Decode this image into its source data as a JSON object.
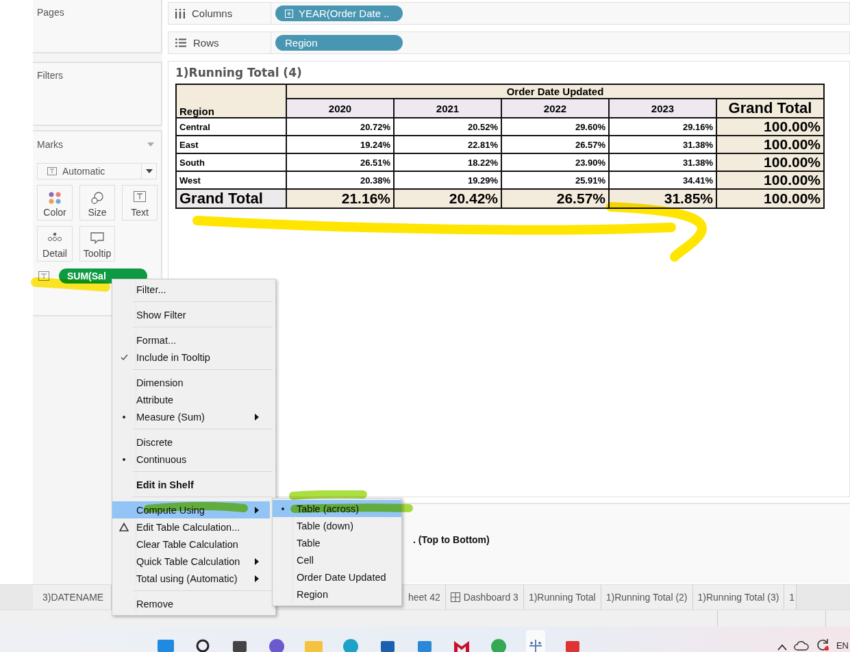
{
  "panels": {
    "pages": "Pages",
    "filters": "Filters",
    "marks": "Marks"
  },
  "mark_type": "Automatic",
  "mark_buttons": [
    {
      "label": "Color",
      "kind": "color"
    },
    {
      "label": "Size",
      "kind": "size"
    },
    {
      "label": "Text",
      "kind": "text"
    },
    {
      "label": "Detail",
      "kind": "detail"
    },
    {
      "label": "Tooltip",
      "kind": "tooltip"
    }
  ],
  "mark_pill": {
    "label": "SUM(Sal"
  },
  "shelves": [
    {
      "label": "Columns",
      "kind": "columns",
      "pill": "YEAR(Order Date ..",
      "pill_icon": true
    },
    {
      "label": "Rows",
      "kind": "rows",
      "pill": "Region",
      "pill_icon": false
    }
  ],
  "view": {
    "title": "1)Running Total (4)",
    "table": {
      "group_header": "Order Date Updated",
      "row_header": "Region",
      "columns": [
        "2020",
        "2021",
        "2022",
        "2023"
      ],
      "total_header": "Grand Total",
      "rows": [
        {
          "label": "Central",
          "values": [
            "20.72%",
            "20.52%",
            "29.60%",
            "29.16%"
          ],
          "total": "100.00%"
        },
        {
          "label": "East",
          "values": [
            "19.24%",
            "22.81%",
            "26.57%",
            "31.38%"
          ],
          "total": "100.00%"
        },
        {
          "label": "South",
          "values": [
            "26.51%",
            "18.22%",
            "23.90%",
            "31.38%"
          ],
          "total": "100.00%"
        },
        {
          "label": "West",
          "values": [
            "20.38%",
            "19.29%",
            "25.91%",
            "34.41%"
          ],
          "total": "100.00%"
        }
      ],
      "grand_total": {
        "label": "Grand Total",
        "values": [
          "21.16%",
          "20.42%",
          "26.57%",
          "31.85%"
        ],
        "total": "100.00%"
      }
    }
  },
  "bottom_panel_text": ". (Top to Bottom)",
  "context_menu": {
    "groups": [
      [
        {
          "label": "Filter...",
          "kind": "plain",
          "checked": false,
          "submenu": false,
          "selected": false
        }
      ],
      [
        {
          "label": "Show Filter",
          "kind": "plain",
          "checked": false,
          "submenu": false,
          "selected": false
        }
      ],
      [
        {
          "label": "Format...",
          "kind": "plain",
          "checked": false,
          "submenu": false,
          "selected": false
        },
        {
          "label": "Include in Tooltip",
          "kind": "tick",
          "checked": true,
          "submenu": false,
          "selected": false
        }
      ],
      [
        {
          "label": "Dimension",
          "kind": "plain",
          "checked": false,
          "submenu": false,
          "selected": false
        },
        {
          "label": "Attribute",
          "kind": "plain",
          "checked": false,
          "submenu": false,
          "selected": false
        },
        {
          "label": "Measure (Sum)",
          "kind": "dot",
          "checked": true,
          "submenu": true,
          "selected": false
        }
      ],
      [
        {
          "label": "Discrete",
          "kind": "plain",
          "checked": false,
          "submenu": false,
          "selected": false
        },
        {
          "label": "Continuous",
          "kind": "dot",
          "checked": true,
          "submenu": false,
          "selected": false
        }
      ],
      [
        {
          "label": "Edit in Shelf",
          "kind": "plain",
          "bold": true,
          "checked": false,
          "submenu": false,
          "selected": false
        }
      ],
      [
        {
          "label": "Compute Using",
          "kind": "plain",
          "checked": false,
          "submenu": true,
          "selected": true
        },
        {
          "label": "Edit Table Calculation...",
          "kind": "delta",
          "checked": false,
          "submenu": false,
          "selected": false
        },
        {
          "label": "Clear Table Calculation",
          "kind": "plain",
          "checked": false,
          "submenu": false,
          "selected": false
        },
        {
          "label": "Quick Table Calculation",
          "kind": "plain",
          "checked": false,
          "submenu": true,
          "selected": false
        },
        {
          "label": "Total using (Automatic)",
          "kind": "plain",
          "checked": false,
          "submenu": true,
          "selected": false
        }
      ],
      [
        {
          "label": "Remove",
          "kind": "plain",
          "checked": false,
          "submenu": false,
          "selected": false
        }
      ]
    ]
  },
  "submenu": [
    {
      "label": "Table (across)",
      "checked": true,
      "selected": true
    },
    {
      "label": "Table (down)",
      "checked": false,
      "selected": false
    },
    {
      "label": "Table",
      "checked": false,
      "selected": false
    },
    {
      "label": "Cell",
      "checked": false,
      "selected": false
    },
    {
      "label": "Order Date Updated",
      "checked": false,
      "selected": false
    },
    {
      "label": "Region",
      "checked": false,
      "selected": false
    }
  ],
  "sheet_tabs": [
    {
      "label": "3)DATENAME",
      "kind": "sheet"
    },
    {
      "label": "heet 42",
      "kind": "sheet"
    },
    {
      "label": "Dashboard 3",
      "kind": "dashboard"
    },
    {
      "label": "1)Running Total",
      "kind": "sheet"
    },
    {
      "label": "1)Running Total (2)",
      "kind": "sheet"
    },
    {
      "label": "1)Running Total (3)",
      "kind": "sheet"
    },
    {
      "label": "1",
      "kind": "sheet"
    }
  ],
  "taskbar": {
    "language": "EN"
  }
}
